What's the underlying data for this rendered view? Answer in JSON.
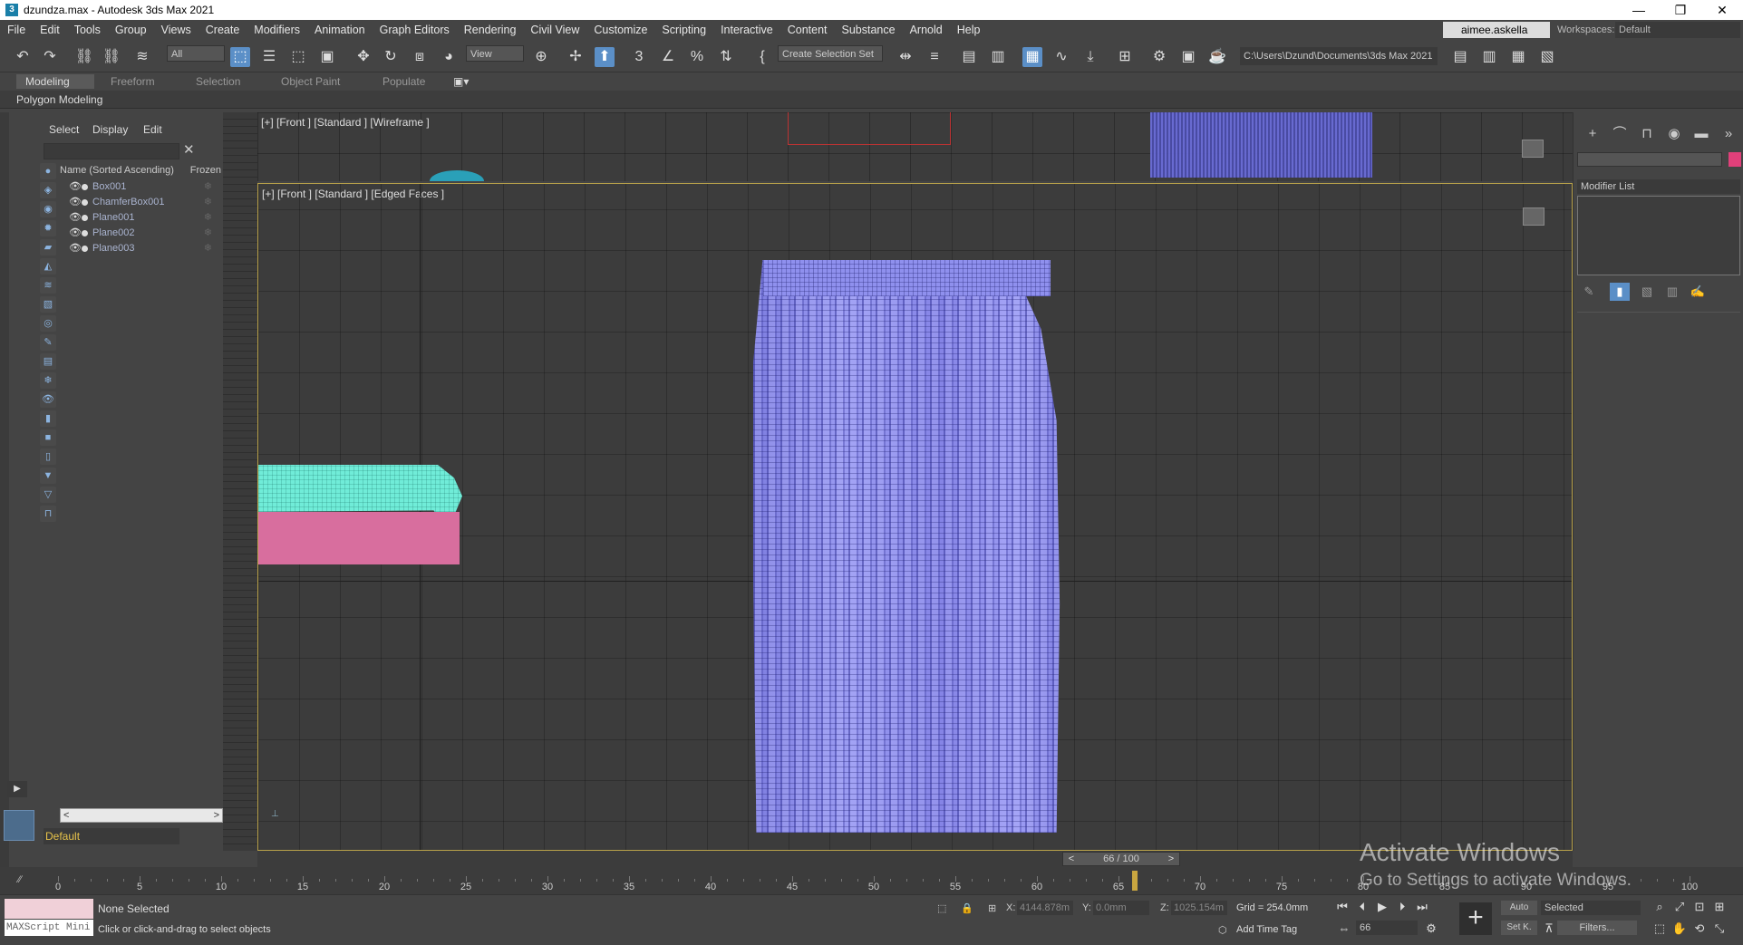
{
  "window": {
    "title": "dzundza.max - Autodesk 3ds Max 2021",
    "app_icon": "3",
    "minimize": "—",
    "restore": "❐",
    "close": "✕"
  },
  "menu": {
    "items": [
      "File",
      "Edit",
      "Tools",
      "Group",
      "Views",
      "Create",
      "Modifiers",
      "Animation",
      "Graph Editors",
      "Rendering",
      "Civil View",
      "Customize",
      "Scripting",
      "Interactive",
      "Content",
      "Substance",
      "Arnold",
      "Help"
    ],
    "user": "aimee.askella",
    "workspaces_label": "Workspaces:",
    "workspace": "Default"
  },
  "toolbar": {
    "filter": "All",
    "ref_coord": "View",
    "selection_set": "Create Selection Set",
    "project_path": "C:\\Users\\Dzund\\Documents\\3ds Max 2021"
  },
  "ribbon": {
    "tabs": [
      "Modeling",
      "Freeform",
      "Selection",
      "Object Paint",
      "Populate"
    ],
    "active": "Modeling",
    "panel": "Polygon Modeling"
  },
  "scene_explorer": {
    "tabs": [
      "Select",
      "Display",
      "Edit"
    ],
    "clear": "✕",
    "header_name": "Name (Sorted Ascending)",
    "header_frozen": "Frozen",
    "objects": [
      "Box001",
      "ChamferBox001",
      "Plane001",
      "Plane002",
      "Plane003"
    ],
    "layer": "Default",
    "scroll_left": "<",
    "scroll_right": ">"
  },
  "viewports": {
    "top_label": "[+] [Front ] [Standard ] [Wireframe ]",
    "main_label": "[+] [Front ] [Standard ] [Edged Faces ]",
    "edge_label_top": "[+] [",
    "edge_label_main": "[+] [I"
  },
  "command_panel": {
    "modifier_list": "Modifier List"
  },
  "time_slider": {
    "frame_display": "66 / 100",
    "prev": "<",
    "next": ">"
  },
  "trackbar": {
    "ticks": [
      "0",
      "5",
      "10",
      "15",
      "20",
      "25",
      "30",
      "35",
      "40",
      "45",
      "50",
      "55",
      "60",
      "65",
      "70",
      "75",
      "80",
      "85",
      "90",
      "95",
      "100"
    ],
    "current_frame": 66
  },
  "status": {
    "selection": "None Selected",
    "prompt": "Click or click-and-drag to select objects",
    "maxscript": "MAXScript Mini",
    "x_label": "X:",
    "x_value": "4144.878m",
    "y_label": "Y:",
    "y_value": "0.0mm",
    "z_label": "Z:",
    "z_value": "1025.154m",
    "grid": "Grid = 254.0mm",
    "add_time_tag": "Add Time Tag",
    "auto": "Auto",
    "set_key": "Set K.",
    "selected": "Selected",
    "filters": "Filters...",
    "frame": "66"
  },
  "watermark": {
    "title": "Activate Windows",
    "subtitle": "Go to Settings to activate Windows."
  },
  "colors": {
    "accent": "#5b8fc7",
    "curtain": "#8f90ee",
    "tablecloth": "#70ecd8",
    "chamferbox": "#d86e9e",
    "object_color": "#e0407a",
    "viewport_border": "#b8a14a"
  }
}
